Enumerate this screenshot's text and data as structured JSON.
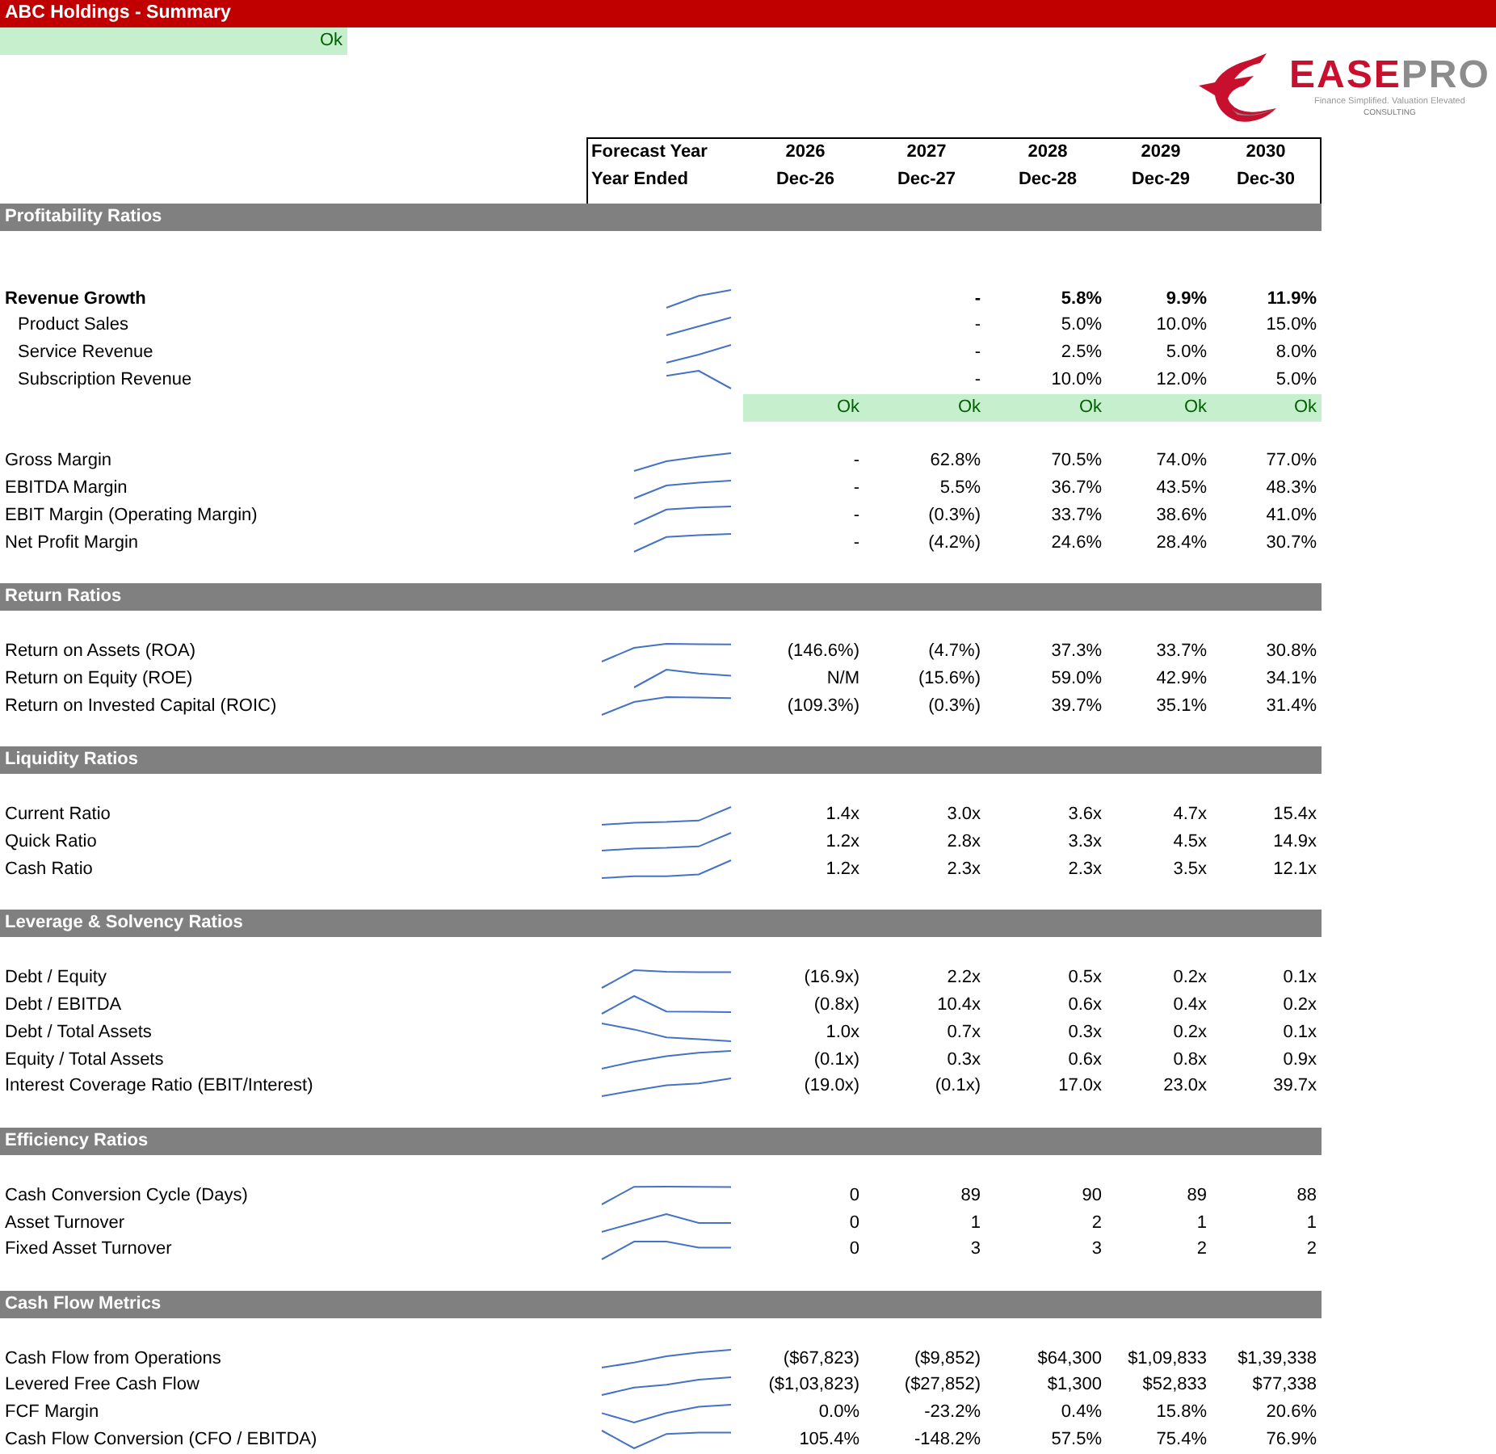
{
  "title": "ABC Holdings - Summary",
  "status": "Ok",
  "logo": {
    "name_parts": [
      "EASE",
      "PRO"
    ],
    "tagline": "Finance Simplified. Valuation Elevated",
    "sub": "CONSULTING"
  },
  "header": [
    {
      "label": "Forecast Year",
      "values": [
        "2026",
        "2027",
        "2028",
        "2029",
        "2030"
      ]
    },
    {
      "label": "Year Ended",
      "values": [
        "Dec-26",
        "Dec-27",
        "Dec-28",
        "Dec-29",
        "Dec-30"
      ]
    }
  ],
  "sections": [
    {
      "title": "Profitability Ratios",
      "groups": [
        [
          {
            "kind": "metric",
            "label": "Revenue Growth",
            "bold": true,
            "values": [
              "-",
              "5.8%",
              "9.9%",
              "11.9%"
            ],
            "children": [
              {
                "kind": "metric",
                "label": "Product Sales",
                "bold": false,
                "values": [
                  "-",
                  "5.0%",
                  "10.0%",
                  "15.0%"
                ]
              },
              {
                "kind": "metric",
                "label": "Service Revenue",
                "bold": false,
                "values": [
                  "-",
                  "2.5%",
                  "5.0%",
                  "8.0%"
                ]
              },
              {
                "kind": "metric",
                "label": "Subscription Revenue",
                "bold": false,
                "values": [
                  "-",
                  "10.0%",
                  "12.0%",
                  "5.0%"
                ]
              }
            ]
          },
          {
            "kind": "check",
            "values": [
              "Ok",
              "Ok",
              "Ok",
              "Ok",
              "Ok"
            ]
          }
        ],
        [
          {
            "kind": "metric",
            "label": "Gross Margin",
            "bold": false,
            "values": [
              "-",
              "62.8%",
              "70.5%",
              "74.0%",
              "77.0%"
            ]
          },
          {
            "kind": "metric",
            "label": "EBITDA Margin",
            "bold": false,
            "values": [
              "-",
              "5.5%",
              "36.7%",
              "43.5%",
              "48.3%"
            ]
          },
          {
            "kind": "metric",
            "label": "EBIT Margin (Operating Margin)",
            "bold": false,
            "values": [
              "-",
              "(0.3%)",
              "33.7%",
              "38.6%",
              "41.0%"
            ]
          },
          {
            "kind": "metric",
            "label": "Net Profit Margin",
            "bold": false,
            "values": [
              "-",
              "(4.2%)",
              "24.6%",
              "28.4%",
              "30.7%"
            ]
          }
        ]
      ]
    },
    {
      "title": "Return Ratios",
      "groups": [
        [
          {
            "kind": "metric",
            "label": "Return on Assets (ROA)",
            "bold": false,
            "values": [
              "(146.6%)",
              "(4.7%)",
              "37.3%",
              "33.7%",
              "30.8%"
            ]
          },
          {
            "kind": "metric",
            "label": "Return on Equity (ROE)",
            "bold": false,
            "values": [
              "N/M",
              "(15.6%)",
              "59.0%",
              "42.9%",
              "34.1%"
            ]
          },
          {
            "kind": "metric",
            "label": "Return on Invested Capital (ROIC)",
            "bold": false,
            "values": [
              "(109.3%)",
              "(0.3%)",
              "39.7%",
              "35.1%",
              "31.4%"
            ]
          }
        ]
      ]
    },
    {
      "title": "Liquidity Ratios",
      "groups": [
        [
          {
            "kind": "metric",
            "label": "Current Ratio",
            "bold": false,
            "values": [
              "1.4x",
              "3.0x",
              "3.6x",
              "4.7x",
              "15.4x"
            ]
          },
          {
            "kind": "metric",
            "label": "Quick Ratio",
            "bold": false,
            "values": [
              "1.2x",
              "2.8x",
              "3.3x",
              "4.5x",
              "14.9x"
            ]
          },
          {
            "kind": "metric",
            "label": "Cash Ratio",
            "bold": false,
            "values": [
              "1.2x",
              "2.3x",
              "2.3x",
              "3.5x",
              "12.1x"
            ]
          }
        ]
      ]
    },
    {
      "title": "Leverage & Solvency Ratios",
      "groups": [
        [
          {
            "kind": "metric",
            "label": "Debt / Equity",
            "bold": false,
            "values": [
              "(16.9x)",
              "2.2x",
              "0.5x",
              "0.2x",
              "0.1x"
            ]
          },
          {
            "kind": "metric",
            "label": "Debt / EBITDA",
            "bold": false,
            "values": [
              "(0.8x)",
              "10.4x",
              "0.6x",
              "0.4x",
              "0.2x"
            ]
          },
          {
            "kind": "metric",
            "label": "Debt / Total Assets",
            "bold": false,
            "values": [
              "1.0x",
              "0.7x",
              "0.3x",
              "0.2x",
              "0.1x"
            ]
          },
          {
            "kind": "metric",
            "label": "Equity / Total Assets",
            "bold": false,
            "values": [
              "(0.1x)",
              "0.3x",
              "0.6x",
              "0.8x",
              "0.9x"
            ]
          },
          {
            "kind": "metric",
            "label": "Interest Coverage Ratio (EBIT/Interest)",
            "bold": false,
            "values": [
              "(19.0x)",
              "(0.1x)",
              "17.0x",
              "23.0x",
              "39.7x"
            ]
          }
        ]
      ]
    },
    {
      "title": "Efficiency Ratios",
      "groups": [
        [
          {
            "kind": "metric",
            "label": "Cash Conversion Cycle (Days)",
            "bold": false,
            "values": [
              "0",
              "89",
              "90",
              "89",
              "88"
            ]
          },
          {
            "kind": "metric",
            "label": "Asset Turnover",
            "bold": false,
            "values": [
              "0",
              "1",
              "2",
              "1",
              "1"
            ]
          },
          {
            "kind": "metric",
            "label": "Fixed Asset Turnover",
            "bold": false,
            "values": [
              "0",
              "3",
              "3",
              "2",
              "2"
            ]
          }
        ]
      ]
    },
    {
      "title": "Cash Flow Metrics",
      "groups": [
        [
          {
            "kind": "metric",
            "label": "Cash Flow from Operations",
            "bold": false,
            "values": [
              "($67,823)",
              "($9,852)",
              "$64,300",
              "$1,09,833",
              "$1,39,338"
            ]
          },
          {
            "kind": "metric",
            "label": "Levered Free Cash Flow",
            "bold": false,
            "values": [
              "($1,03,823)",
              "($27,852)",
              "$1,300",
              "$52,833",
              "$77,338"
            ]
          },
          {
            "kind": "metric",
            "label": "FCF Margin",
            "bold": false,
            "values": [
              "0.0%",
              "-23.2%",
              "0.4%",
              "15.8%",
              "20.6%"
            ]
          },
          {
            "kind": "metric",
            "label": "Cash Flow Conversion (CFO / EBITDA)",
            "bold": false,
            "values": [
              "105.4%",
              "-148.2%",
              "57.5%",
              "75.4%",
              "76.9%"
            ]
          }
        ]
      ]
    }
  ]
}
